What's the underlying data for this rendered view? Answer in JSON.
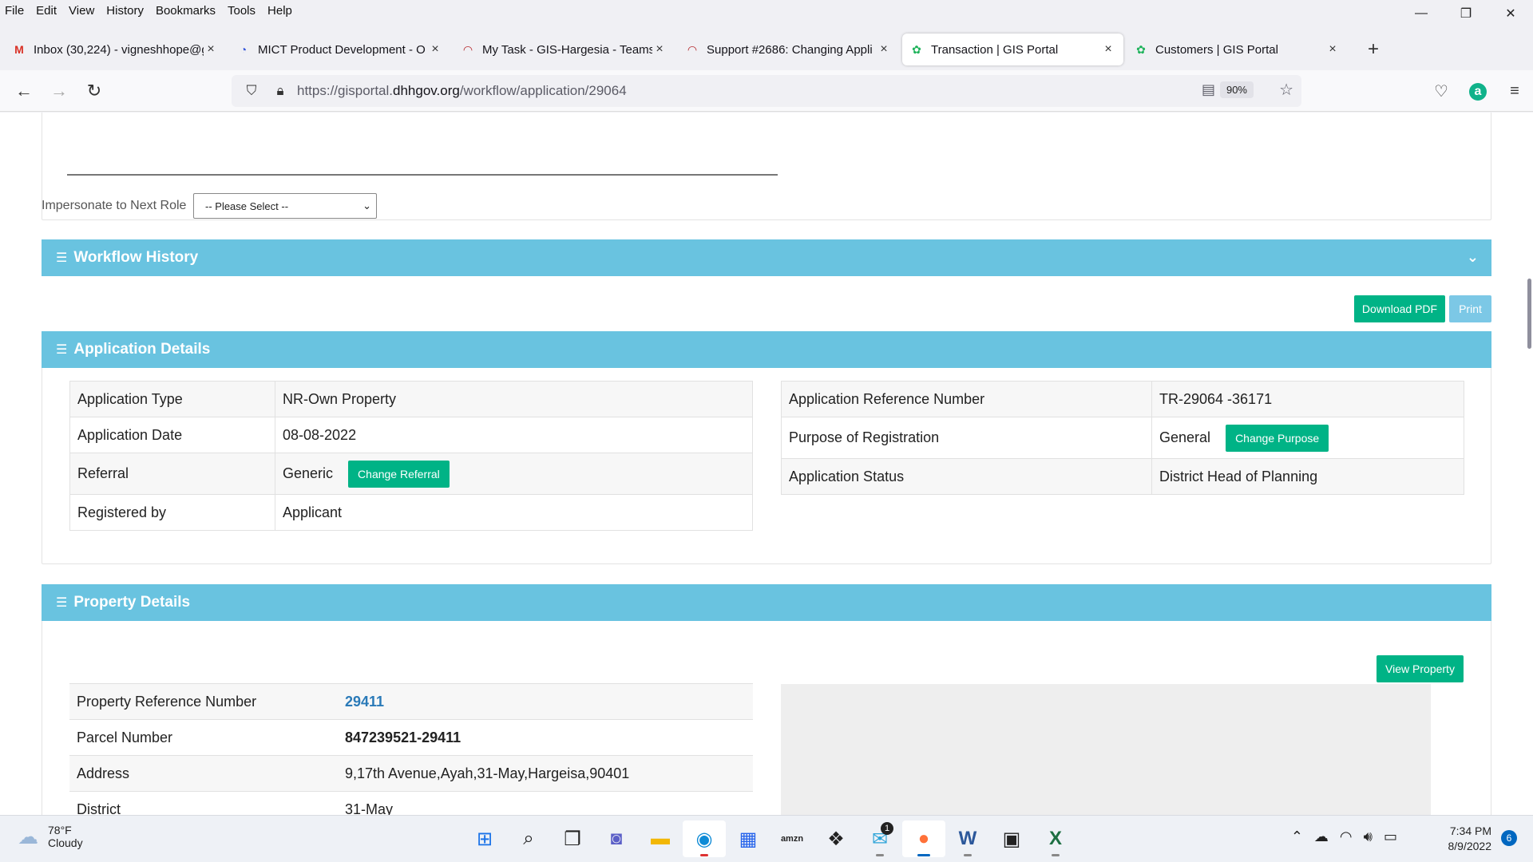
{
  "menu": [
    "File",
    "Edit",
    "View",
    "History",
    "Bookmarks",
    "Tools",
    "Help"
  ],
  "window_controls": {
    "minimize": "—",
    "restore": "❐",
    "close": "✕"
  },
  "tabs": [
    {
      "title": "Inbox (30,224) - vigneshhope@g",
      "icon": "gmail-icon"
    },
    {
      "title": "MICT Product Development - O",
      "icon": "clickup-icon"
    },
    {
      "title": "My Task - GIS-Hargesia - Teams",
      "icon": "redmine-icon"
    },
    {
      "title": "Support #2686: Changing Appli",
      "icon": "redmine-icon"
    },
    {
      "title": "Transaction | GIS Portal",
      "icon": "gisportal-icon",
      "active": true
    },
    {
      "title": "Customers | GIS Portal",
      "icon": "gisportal-icon"
    }
  ],
  "url": {
    "prefix": "https://gisportal.",
    "domain": "dhhgov.org",
    "path": "/workflow/application/29064"
  },
  "zoom": "90%",
  "page": {
    "impersonate_label": "Impersonate to Next Role",
    "impersonate_select": "-- Please Select --",
    "workflow_history_title": "Workflow History",
    "download_pdf": "Download PDF",
    "print": "Print",
    "application_details_title": "Application Details",
    "app_left": [
      {
        "label": "Application Type",
        "value": "NR-Own Property"
      },
      {
        "label": "Application Date",
        "value": "08-08-2022"
      },
      {
        "label": "Referral",
        "value": "Generic",
        "button": "Change Referral"
      },
      {
        "label": "Registered by",
        "value": "Applicant"
      }
    ],
    "app_right": [
      {
        "label": "Application Reference Number",
        "value": "TR-29064 -36171"
      },
      {
        "label": "Purpose of Registration",
        "value": "General",
        "button": "Change Purpose"
      },
      {
        "label": "Application Status",
        "value": "District Head of Planning"
      }
    ],
    "property_details_title": "Property Details",
    "view_property": "View Property",
    "property": [
      {
        "label": "Property Reference Number",
        "value": "29411"
      },
      {
        "label": "Parcel Number",
        "value": "847239521-29411"
      },
      {
        "label": "Address",
        "value": "9,17th Avenue,Ayah,31-May,Hargeisa,90401"
      },
      {
        "label": "District",
        "value": "31-May"
      }
    ]
  },
  "taskbar": {
    "temp": "78°F",
    "weather": "Cloudy",
    "time": "7:34 PM",
    "date": "8/9/2022",
    "notifications": "6",
    "mail_badge": "1"
  },
  "colors": {
    "panel_header": "#69c3e0",
    "green_button": "#00b386",
    "link": "#2a7ab8"
  }
}
